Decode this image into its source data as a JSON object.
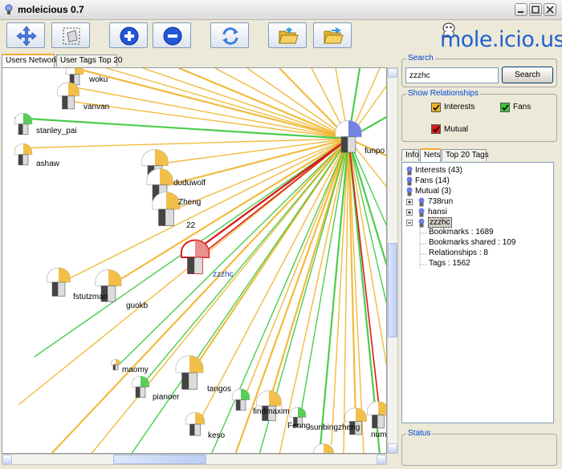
{
  "app": {
    "title": "moleicious 0.7",
    "logo": "mole.icio.us"
  },
  "window_controls": [
    "minimize",
    "maximize",
    "close"
  ],
  "toolbar": {
    "buttons": [
      {
        "name": "move-button",
        "icon": "arrows-move-icon"
      },
      {
        "name": "select-button",
        "icon": "select-area-icon"
      },
      {
        "name": "zoom-in-button",
        "icon": "plus-circle-icon"
      },
      {
        "name": "zoom-out-button",
        "icon": "minus-circle-icon"
      },
      {
        "name": "refresh-button",
        "icon": "refresh-icon"
      },
      {
        "name": "open-button",
        "icon": "folder-open-icon"
      },
      {
        "name": "save-button",
        "icon": "folder-save-icon"
      }
    ]
  },
  "left_tabs": [
    {
      "label": "Users Network",
      "active": true
    },
    {
      "label": "User Tags Top 20",
      "active": false
    }
  ],
  "graph": {
    "hub_label": "funpo",
    "nodes": [
      {
        "id": "woku",
        "label": "woku"
      },
      {
        "id": "vanvan",
        "label": "vanvan"
      },
      {
        "id": "stanley_pai",
        "label": "stanley_pai"
      },
      {
        "id": "ashaw",
        "label": "ashaw"
      },
      {
        "id": "duduwolf",
        "label": "duduwolf"
      },
      {
        "id": "Zheng",
        "label": "Zheng"
      },
      {
        "id": "22",
        "label": "22"
      },
      {
        "id": "zzzhc",
        "label": "zzzhc"
      },
      {
        "id": "fstutzman",
        "label": "fstutzman"
      },
      {
        "id": "guokb",
        "label": "guokb"
      },
      {
        "id": "maomy",
        "label": "maomy"
      },
      {
        "id": "pianoer",
        "label": "pianoer"
      },
      {
        "id": "tangos",
        "label": "tangos"
      },
      {
        "id": "keso",
        "label": "keso"
      },
      {
        "id": "findmaxim",
        "label": "findmaxim"
      },
      {
        "id": "Fenng",
        "label": "Fenng"
      },
      {
        "id": "sunbingzheng",
        "label": "sunbingzheng"
      },
      {
        "id": "num",
        "label": "num"
      }
    ],
    "colors": {
      "interests": "#f0b429",
      "fans": "#39c739",
      "mutual": "#d81e1e",
      "selected": "#d81e1e",
      "hub": "#5a6fe0"
    }
  },
  "search": {
    "title": "Search",
    "value": "zzzhc",
    "button": "Search"
  },
  "relationships": {
    "title": "Show Relationships",
    "items": [
      {
        "label": "Interests",
        "color": "#f0b429",
        "checked": true
      },
      {
        "label": "Fans",
        "color": "#39c739",
        "checked": true
      },
      {
        "label": "Mutual",
        "color": "#d81e1e",
        "checked": true
      }
    ]
  },
  "right_tabs": [
    {
      "label": "Info",
      "active": false
    },
    {
      "label": "Nets",
      "active": true
    },
    {
      "label": "Top 20 Tags",
      "active": false
    }
  ],
  "tree": {
    "items": [
      {
        "label": "Interests (43)"
      },
      {
        "label": "Fans (14)"
      },
      {
        "label": "Mutual (3)"
      },
      {
        "label": "738run"
      },
      {
        "label": "hansi"
      },
      {
        "label": "zzzhc"
      },
      {
        "label": "Bookmarks : 1689"
      },
      {
        "label": "Bookmarks shared : 109"
      },
      {
        "label": "Relationships : 8"
      },
      {
        "label": "Tags : 1562"
      }
    ]
  },
  "status": {
    "title": "Status",
    "text": ""
  }
}
